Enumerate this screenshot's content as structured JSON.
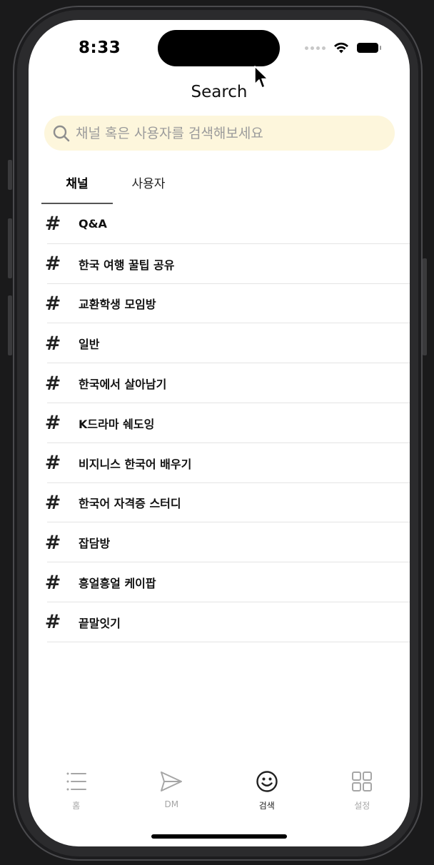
{
  "status": {
    "time": "8:33"
  },
  "header": {
    "title": "Search"
  },
  "search": {
    "placeholder": "채널 혹은 사용자를 검색해보세요",
    "value": ""
  },
  "tabs": [
    {
      "label": "채널",
      "active": true
    },
    {
      "label": "사용자",
      "active": false
    }
  ],
  "channels": [
    {
      "icon": "hash-icon",
      "label": "Q&A"
    },
    {
      "icon": "hash-icon",
      "label": "한국 여행 꿀팁 공유"
    },
    {
      "icon": "hash-icon",
      "label": "교환학생 모임방"
    },
    {
      "icon": "hash-icon",
      "label": "일반"
    },
    {
      "icon": "hash-icon",
      "label": "한국에서 살아남기"
    },
    {
      "icon": "hash-icon",
      "label": "K드라마 쉐도잉"
    },
    {
      "icon": "hash-icon",
      "label": "비지니스 한국어 배우기"
    },
    {
      "icon": "hash-icon",
      "label": "한국어 자격증 스터디"
    },
    {
      "icon": "hash-icon",
      "label": "잡담방"
    },
    {
      "icon": "hash-icon",
      "label": "흥얼흥얼 케이팝"
    },
    {
      "icon": "hash-icon",
      "label": "끝말잇기"
    }
  ],
  "tabbar": [
    {
      "icon": "list-icon",
      "label": "홈",
      "active": false
    },
    {
      "icon": "send-icon",
      "label": "DM",
      "active": false
    },
    {
      "icon": "smiley-icon",
      "label": "검색",
      "active": true
    },
    {
      "icon": "grid-icon",
      "label": "설정",
      "active": false
    }
  ],
  "colors": {
    "search_bg": "#fdf6dc",
    "active_tab": "#222222",
    "inactive_tab": "#a6a6a6"
  }
}
